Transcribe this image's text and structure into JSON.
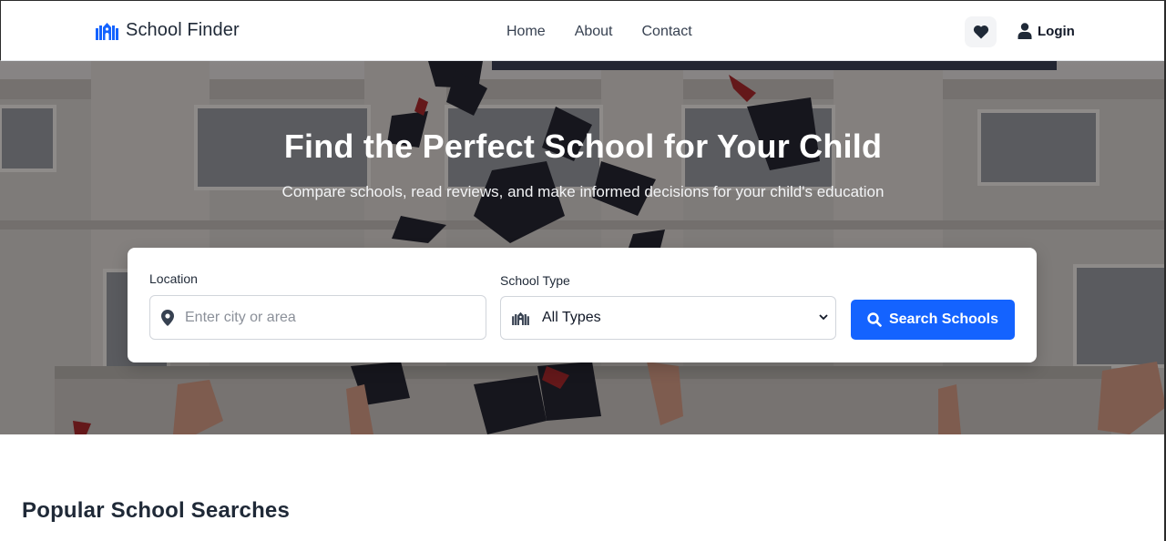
{
  "brand": {
    "name": "School Finder",
    "icon": "school-icon",
    "color": "#1463ff"
  },
  "nav": {
    "links": [
      {
        "label": "Home"
      },
      {
        "label": "About"
      },
      {
        "label": "Contact"
      }
    ],
    "favorites_icon": "heart-icon",
    "login": {
      "label": "Login",
      "icon": "user-icon"
    }
  },
  "hero": {
    "title": "Find the Perfect School for Your Child",
    "subtitle": "Compare schools, read reviews, and make informed decisions for your child's education"
  },
  "search": {
    "location": {
      "label": "Location",
      "placeholder": "Enter city or area",
      "value": "",
      "icon": "map-pin-icon"
    },
    "school_type": {
      "label": "School Type",
      "selected": "All Types",
      "icon": "school-icon"
    },
    "button": {
      "label": "Search Schools",
      "icon": "search-icon",
      "color": "#1463ff"
    }
  },
  "popular": {
    "title": "Popular School Searches"
  }
}
